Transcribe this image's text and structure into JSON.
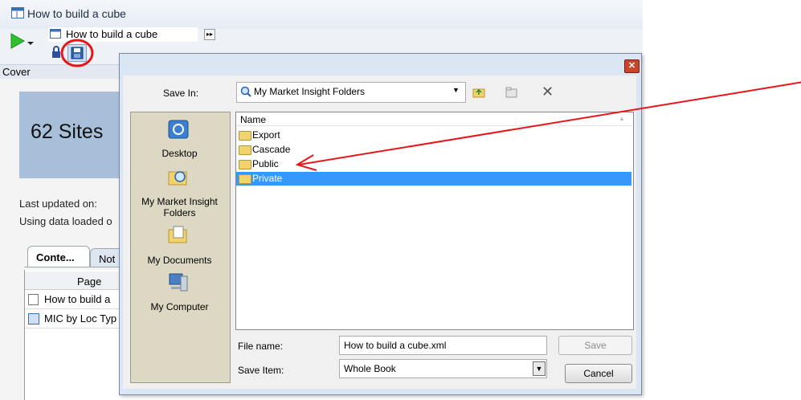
{
  "app": {
    "window_title": "How to build a cube",
    "book_dropdown": "How to build a cube",
    "cover_label": "Cover",
    "banner_text": "62  Sites",
    "last_updated_label": "Last updated on:",
    "data_loaded_label": "Using data loaded o",
    "tabs": [
      {
        "label": "Conte...",
        "selected": true
      },
      {
        "label": "Not",
        "selected": false
      }
    ],
    "pages_grid": {
      "header": "Page",
      "rows": [
        {
          "label": "How to build a"
        },
        {
          "label": "MIC by Loc Typ"
        }
      ]
    }
  },
  "dialog": {
    "close_glyph": "✕",
    "save_in_label": "Save In:",
    "location": "My Market Insight Folders",
    "column_name": "Name",
    "places": [
      {
        "label": "Desktop",
        "icon": "desktop-icon"
      },
      {
        "label": "My Market Insight Folders",
        "icon": "market-insight-folder-icon"
      },
      {
        "label": "My Documents",
        "icon": "documents-icon"
      },
      {
        "label": "My Computer",
        "icon": "computer-icon"
      }
    ],
    "files": [
      {
        "name": "Export",
        "selected": false
      },
      {
        "name": "Cascade",
        "selected": false
      },
      {
        "name": "Public",
        "selected": false
      },
      {
        "name": "Private",
        "selected": true
      }
    ],
    "file_name_label": "File name:",
    "file_name_value": "How to build a cube.xml",
    "save_item_label": "Save Item:",
    "save_item_value": "Whole Book",
    "save_button": "Save",
    "cancel_button": "Cancel",
    "delete_glyph": "✕"
  },
  "colors": {
    "selection": "#3399ff",
    "annotation": "#e8161b"
  }
}
